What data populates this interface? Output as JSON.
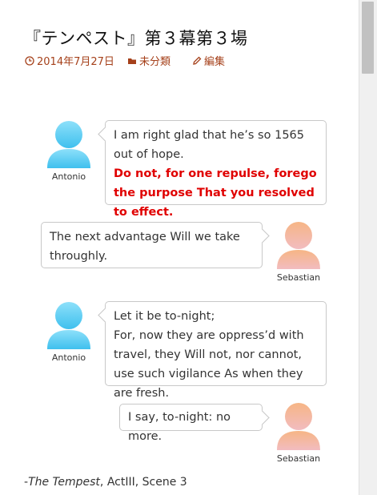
{
  "post": {
    "title": "『テンペスト』第３幕第３場",
    "date": "2014年7月27日",
    "category": "未分類",
    "edit": "編集"
  },
  "dialogue": [
    {
      "speaker": "Antonio",
      "lines": [
        "I am right glad that he’s so 1565 out of hope."
      ],
      "highlight": "Do not, for one repulse, forego the purpose That you resolved to effect."
    },
    {
      "speaker": "Sebastian",
      "lines": [
        "The next advantage Will we take throughly."
      ]
    },
    {
      "speaker": "Antonio",
      "lines": [
        "Let it be to-night;",
        "For, now they are oppress’d with travel, they Will not, nor cannot, use such vigilance As when they are fresh."
      ]
    },
    {
      "speaker": "Sebastian",
      "lines": [
        "I say, to-night: no more."
      ]
    }
  ],
  "credit": {
    "prefix": "-",
    "work": "The Tempest",
    "rest": ", ActIII, Scene 3"
  },
  "colors": {
    "meta": "#a5401a",
    "highlight": "#e00000",
    "antonio_avatar": "#5ccdf2",
    "sebastian_avatar": "#f5b98c"
  },
  "icons": {
    "date": "clock-icon",
    "category": "folder-icon",
    "edit": "pencil-icon"
  }
}
